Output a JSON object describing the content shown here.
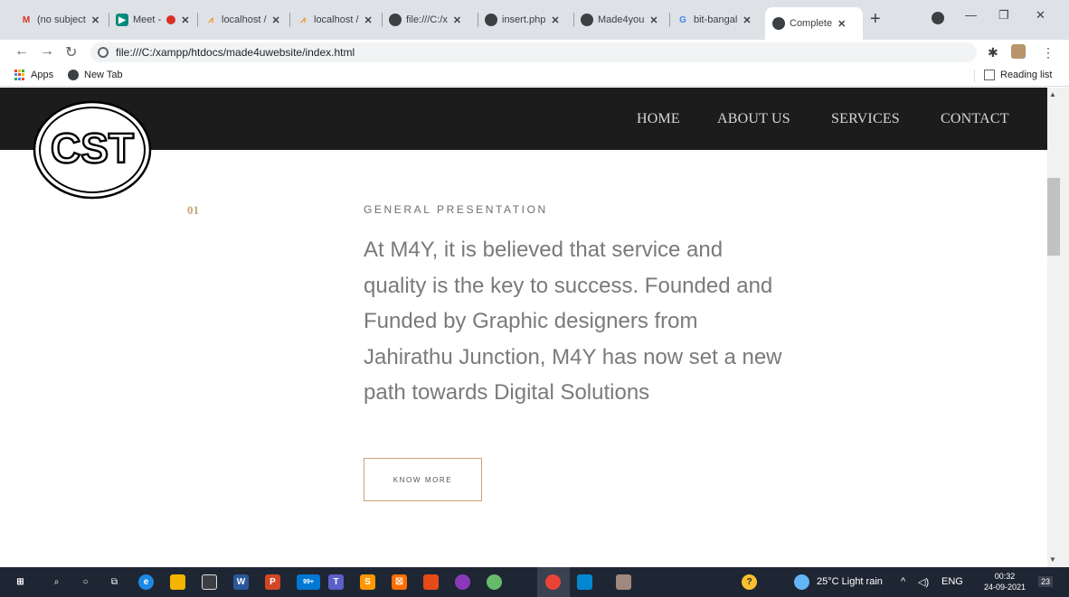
{
  "browser": {
    "tabs": [
      {
        "label": "(no subject",
        "icon": "gmail-icon",
        "color": "#d93025"
      },
      {
        "label": "Meet -",
        "icon": "meet-icon",
        "color": "#00897b"
      },
      {
        "label": "localhost /",
        "icon": "phpmyadmin-icon",
        "color": "#f29111"
      },
      {
        "label": "localhost /",
        "icon": "phpmyadmin-icon",
        "color": "#f29111"
      },
      {
        "label": "file:///C:/x",
        "icon": "globe-icon",
        "color": "#3c4043"
      },
      {
        "label": "insert.php",
        "icon": "globe-icon",
        "color": "#3c4043"
      },
      {
        "label": "Made4you",
        "icon": "globe-icon",
        "color": "#3c4043"
      },
      {
        "label": "bit-bangal",
        "icon": "google-icon",
        "color": "#4285f4"
      },
      {
        "label": "Complete",
        "icon": "globe-icon",
        "color": "#3c4043",
        "active": true
      }
    ],
    "url": "file:///C:/xampp/htdocs/made4uwebsite/index.html",
    "bookmarks": {
      "apps": "Apps",
      "new_tab": "New Tab",
      "reading_list": "Reading list"
    }
  },
  "site": {
    "logo_text": "CST",
    "nav": [
      "HOME",
      "ABOUT US",
      "SERVICES",
      "CONTACT"
    ],
    "section_number": "01",
    "eyebrow": "GENERAL PRESENTATION",
    "lead_lines": [
      "At M4Y, it is believed that service and",
      "quality is the key to success. Founded and",
      "Funded by Graphic designers from",
      "Jahirathu Junction, M4Y has now set a new",
      "path towards Digital Solutions"
    ],
    "cta": "KNOW MORE",
    "accent_color": "#c7a477"
  },
  "taskbar": {
    "weather": "25°C  Light rain",
    "language": "ENG",
    "time": "00:32",
    "date": "24-09-2021",
    "notifications": "23",
    "store_badge": "99+"
  }
}
